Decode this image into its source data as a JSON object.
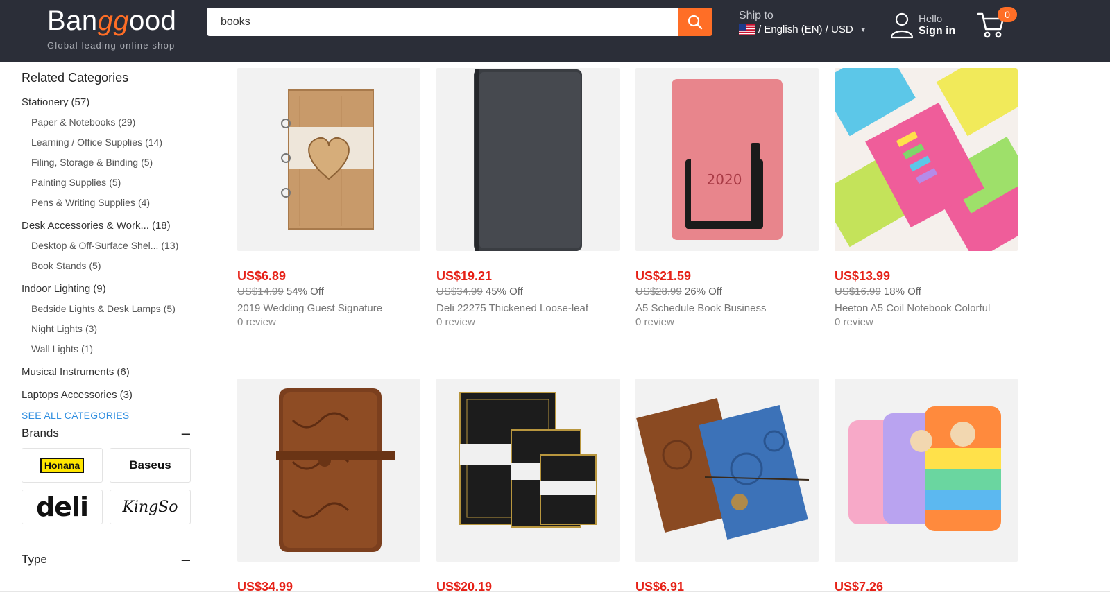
{
  "header": {
    "logo_prefix": "Ban",
    "logo_accent": "gg",
    "logo_suffix": "ood",
    "tagline": "Global leading online shop",
    "search_value": "books",
    "ship_to_label": "Ship to",
    "locale_label": "/ English (EN) / USD",
    "hello_label": "Hello",
    "signin_label": "Sign in",
    "cart_count": "0",
    "accent_color": "#ff6e26",
    "header_bg": "#2b2e38"
  },
  "sidebar": {
    "related_title": "Related Categories",
    "categories": [
      {
        "name": "Stationery",
        "count": "(57)",
        "level": "main"
      },
      {
        "name": "Paper & Notebooks",
        "count": "(29)",
        "level": "sub"
      },
      {
        "name": "Learning / Office Supplies",
        "count": "(14)",
        "level": "sub"
      },
      {
        "name": "Filing, Storage & Binding",
        "count": "(5)",
        "level": "sub"
      },
      {
        "name": "Painting Supplies",
        "count": "(5)",
        "level": "sub"
      },
      {
        "name": "Pens & Writing Supplies",
        "count": "(4)",
        "level": "sub"
      },
      {
        "name": "Desk Accessories & Work...",
        "count": "(18)",
        "level": "main"
      },
      {
        "name": "Desktop & Off-Surface Shel...",
        "count": "(13)",
        "level": "sub"
      },
      {
        "name": "Book Stands",
        "count": "(5)",
        "level": "sub"
      },
      {
        "name": "Indoor Lighting",
        "count": "(9)",
        "level": "main"
      },
      {
        "name": "Bedside Lights & Desk Lamps",
        "count": "(5)",
        "level": "sub"
      },
      {
        "name": "Night Lights",
        "count": "(3)",
        "level": "sub"
      },
      {
        "name": "Wall Lights",
        "count": "(1)",
        "level": "sub"
      },
      {
        "name": "Musical Instruments",
        "count": "(6)",
        "level": "main"
      },
      {
        "name": "Laptops Accessories",
        "count": "(3)",
        "level": "main"
      }
    ],
    "see_all": "SEE ALL CATEGORIES",
    "brands_title": "Brands",
    "brands": [
      "Honana",
      "Baseus",
      "deli",
      "KingSo"
    ],
    "type_title": "Type",
    "collapse_symbol": "–"
  },
  "products": [
    {
      "price": "US$6.89",
      "old_price": "US$14.99",
      "discount": "54% Off",
      "title": "2019 Wedding Guest Signature",
      "reviews": "0 review",
      "image": "wooden-heart-notebook"
    },
    {
      "price": "US$19.21",
      "old_price": "US$34.99",
      "discount": "45% Off",
      "title": "Deli 22275 Thickened Loose-leaf",
      "reviews": "0 review",
      "image": "black-leather-notebook"
    },
    {
      "price": "US$21.59",
      "old_price": "US$28.99",
      "discount": "26% Off",
      "title": "A5 Schedule Book Business",
      "reviews": "0 review",
      "image": "pink-schedule-book",
      "image_text": "2020"
    },
    {
      "price": "US$13.99",
      "old_price": "US$16.99",
      "discount": "18% Off",
      "title": "Heeton A5 Coil Notebook Colorful",
      "reviews": "0 review",
      "image": "colorful-coil-notebooks"
    },
    {
      "price": "US$34.99",
      "image": "brown-embossed-leather-journal"
    },
    {
      "price": "US$20.19",
      "image": "black-gold-notebook-set"
    },
    {
      "price": "US$6.91",
      "image": "leather-clock-journals"
    },
    {
      "price": "US$7.26",
      "image": "pop-it-cat-notebooks"
    }
  ]
}
